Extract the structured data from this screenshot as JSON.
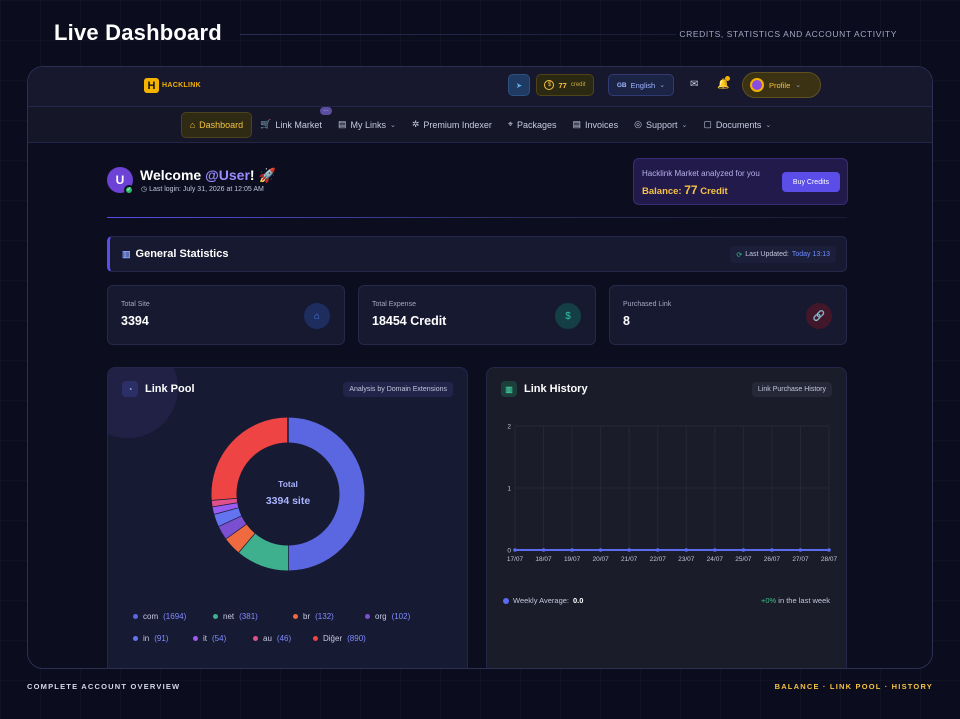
{
  "page": {
    "title": "Live Dashboard",
    "subtitle": "CREDITS, STATISTICS AND ACCOUNT ACTIVITY",
    "footer_left": "COMPLETE ACCOUNT OVERVIEW",
    "footer_right": "BALANCE · LINK POOL · HISTORY"
  },
  "topbar": {
    "logo_text": "HACKLINK",
    "logo_mark": "H",
    "credit_value": "77",
    "credit_unit": "credit",
    "language_flag": "GB",
    "language": "English",
    "profile_label": "Profile",
    "icons": [
      "telegram-icon",
      "coin-icon",
      "mail-icon",
      "bell-icon"
    ]
  },
  "nav": {
    "items": [
      {
        "label": "Dashboard",
        "icon": "⌂",
        "active": true
      },
      {
        "label": "Link Market",
        "icon": "🛒",
        "badge": "···"
      },
      {
        "label": "My Links",
        "icon": "▤",
        "dropdown": true
      },
      {
        "label": "Premium Indexer",
        "icon": "✲"
      },
      {
        "label": "Packages",
        "icon": "⌖"
      },
      {
        "label": "Invoices",
        "icon": "▤"
      },
      {
        "label": "Support",
        "icon": "◎",
        "dropdown": true
      },
      {
        "label": "Documents",
        "icon": "▢",
        "dropdown": true
      }
    ]
  },
  "welcome": {
    "avatar_letter": "U",
    "greeting": "Welcome",
    "username": "@User",
    "suffix": "! 🚀",
    "last_login": "Last login: July 31, 2026 at 12:05 AM"
  },
  "balance": {
    "analyzed_text": "Hacklink Market analyzed for you",
    "label": "Balance:",
    "amount": "77",
    "unit": "Credit",
    "buy_button": "Buy Credits"
  },
  "general_stats": {
    "title": "General Statistics",
    "updated_label": "Last Updated:",
    "updated_value": "Today 13:13",
    "cards": [
      {
        "label": "Total Site",
        "value": "3394",
        "icon": "⌂",
        "icon_color": "#4f7bf0",
        "icon_bg": "#1d2d5e"
      },
      {
        "label": "Total Expense",
        "value": "18454 Credit",
        "icon": "$",
        "icon_color": "#34c3a8",
        "icon_bg": "#133f45"
      },
      {
        "label": "Purchased Link",
        "value": "8",
        "icon": "🔗",
        "icon_color": "#e8506a",
        "icon_bg": "#42172a"
      }
    ]
  },
  "link_pool": {
    "title": "Link Pool",
    "tag": "Analysis by Domain Extensions",
    "center_label": "Total",
    "center_value": "3394 site",
    "legend": [
      {
        "name": "com",
        "count": "(1694)",
        "value": 1694,
        "color": "#5a67e0"
      },
      {
        "name": "net",
        "count": "(381)",
        "value": 381,
        "color": "#3fb08e"
      },
      {
        "name": "br",
        "count": "(132)",
        "value": 132,
        "color": "#ef6a3f"
      },
      {
        "name": "org",
        "count": "(102)",
        "value": 102,
        "color": "#7a4fd0"
      },
      {
        "name": "in",
        "count": "(91)",
        "value": 91,
        "color": "#6474f0"
      },
      {
        "name": "it",
        "count": "(54)",
        "value": 54,
        "color": "#9a5cf0"
      },
      {
        "name": "au",
        "count": "(46)",
        "value": 46,
        "color": "#e0508a"
      },
      {
        "name": "Diğer",
        "count": "(890)",
        "value": 890,
        "color": "#ef4444"
      }
    ]
  },
  "link_history": {
    "title": "Link History",
    "tag": "Link Purchase History",
    "weekly_label": "Weekly Average:",
    "weekly_value": "0.0",
    "change_value": "+0%",
    "change_label": "in the last week"
  },
  "chart_data": [
    {
      "type": "pie",
      "title": "Link Pool",
      "categories": [
        "com",
        "net",
        "br",
        "org",
        "in",
        "it",
        "au",
        "Diğer"
      ],
      "values": [
        1694,
        381,
        132,
        102,
        91,
        54,
        46,
        890
      ]
    },
    {
      "type": "line",
      "title": "Link History",
      "x": [
        "17/07",
        "18/07",
        "19/07",
        "20/07",
        "21/07",
        "22/07",
        "23/07",
        "24/07",
        "25/07",
        "26/07",
        "27/07",
        "28/07"
      ],
      "series": [
        {
          "values": [
            0,
            0,
            0,
            0,
            0,
            0,
            0,
            0,
            0,
            0,
            0,
            0
          ]
        }
      ],
      "ylim": [
        0,
        2
      ],
      "yticks": [
        0,
        1,
        2
      ],
      "grid": true
    }
  ]
}
